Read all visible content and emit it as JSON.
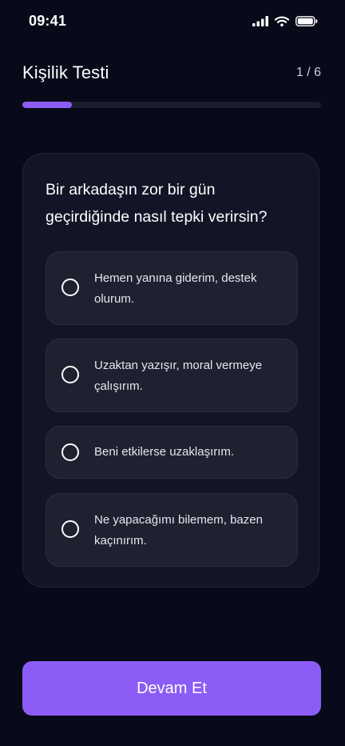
{
  "status_bar": {
    "time": "09:41",
    "icons": [
      "signal-icon",
      "wifi-icon",
      "battery-icon"
    ]
  },
  "header": {
    "title": "Kişilik Testi",
    "step": "1 / 6"
  },
  "progress": {
    "fraction": 0.1667,
    "color": "#8b5cf6"
  },
  "question": {
    "text": "Bir arkadaşın zor bir gün geçirdiğinde nasıl tepki verirsin?",
    "options": [
      {
        "label": "Hemen yanına giderim, destek olurum."
      },
      {
        "label": "Uzaktan yazışır, moral vermeye çalışırım."
      },
      {
        "label": "Beni etkilerse uzaklaşırım."
      },
      {
        "label": "Ne yapacağımı bilemem, bazen kaçınırım."
      }
    ]
  },
  "footer": {
    "continue_label": "Devam Et"
  },
  "colors": {
    "background": "#080a19",
    "card": "#121526",
    "option": "#1e2130",
    "accent": "#8b5cf6"
  }
}
